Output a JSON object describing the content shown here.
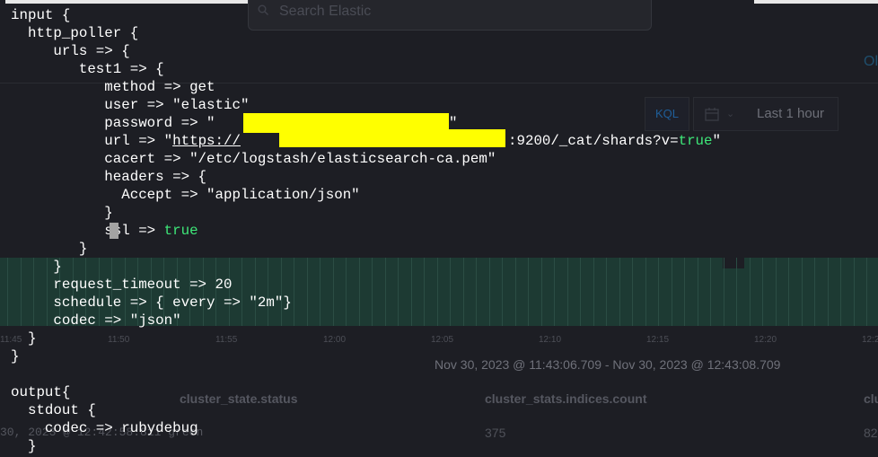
{
  "kibana": {
    "search_placeholder": "Search Elastic",
    "nav_fragment": "Ol",
    "query_language": "KQL",
    "time_range_label": "Last 1 hour",
    "histogram_ticks": [
      "11:45",
      "11:50",
      "11:55",
      "12:00",
      "12:05",
      "12:10",
      "12:15",
      "12:20",
      "12:25"
    ],
    "time_range_text": "Nov 30, 2023 @ 11:43:06.709 - Nov 30, 2023 @ 12:43:08.709",
    "table": {
      "columns": [
        "cluster_state.status",
        "cluster_stats.indices.count",
        "clu"
      ],
      "row_timestamp": "30, 2023 @ 12:42:58.811",
      "row_status": "green",
      "row_indices_count": "375",
      "row_partial": "82"
    }
  },
  "terminal": {
    "lines": [
      "input {",
      "  http_poller {",
      "     urls => {",
      "        test1 => {",
      "           method => get",
      "           user => \"elastic\"",
      "           password => \"",
      "           url => \"",
      "           cacert => \"/etc/logstash/elasticsearch-ca.pem\"",
      "           headers => {",
      "             Accept => \"application/json\"",
      "           }",
      "           ssl => ",
      "        }",
      "     }",
      "     request_timeout => 20",
      "     schedule => { every => \"2m\"}",
      "     codec => \"json\"",
      "  }",
      "}",
      "",
      "output{",
      "  stdout {",
      "    codec => rubydebug",
      "  }"
    ],
    "password_close": "\"",
    "url_prefix": "https://",
    "url_suffix": ":9200/_cat/shards?v=",
    "url_true": "true",
    "url_close": "\"",
    "ssl_value": "true"
  },
  "colors": {
    "terminal_bg": "#1d1e24",
    "text": "#ffffff",
    "boolean": "#3ee879",
    "redaction": "#ffff00",
    "histogram": "#1d3a33"
  }
}
